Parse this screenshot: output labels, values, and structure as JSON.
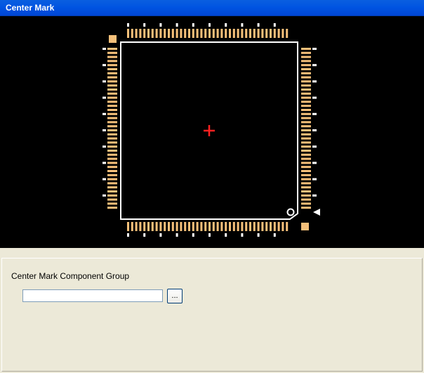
{
  "window": {
    "title": "Center Mark"
  },
  "colors": {
    "pad": "#f5c07a",
    "pin_mark": "#ffffff",
    "outline": "#ffffff",
    "center_mark": "#ff2020",
    "background": "#000000"
  },
  "group": {
    "label": "Center Mark Component Group",
    "value": "",
    "browse_label": "..."
  }
}
